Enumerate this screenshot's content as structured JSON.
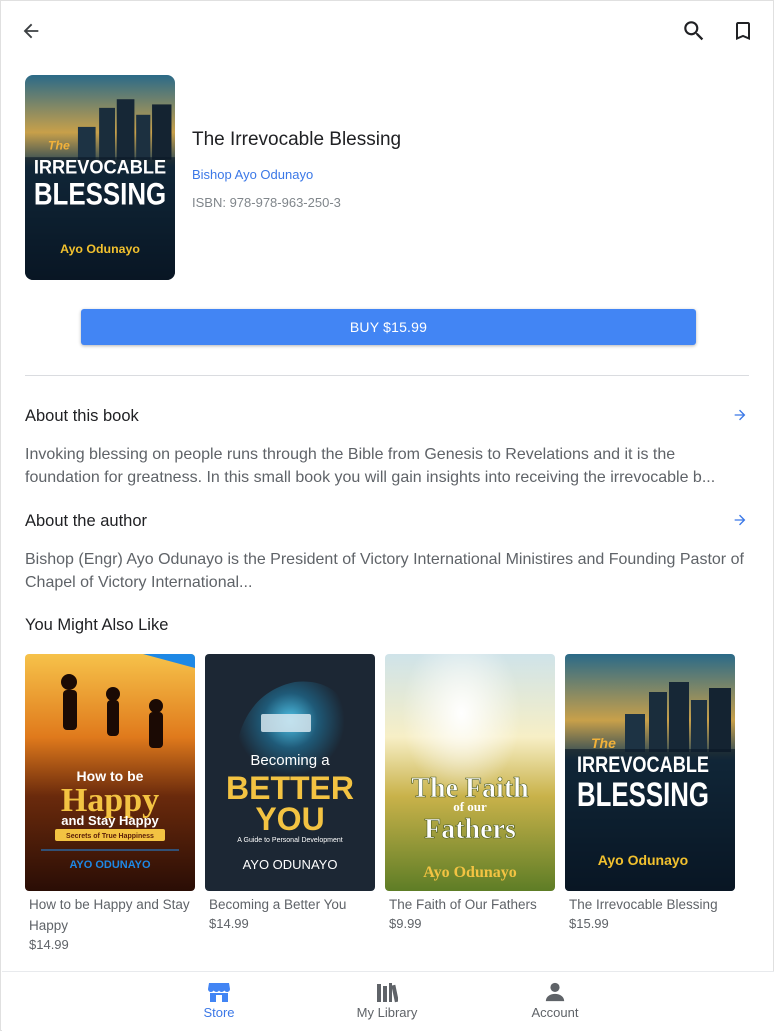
{
  "header": {
    "back_icon": "arrow-left-icon",
    "search_icon": "search-icon",
    "bookmark_icon": "bookmark-icon"
  },
  "book": {
    "title": "The Irrevocable Blessing",
    "author": "Bishop Ayo Odunayo",
    "isbn": "ISBN: 978-978-963-250-3",
    "cover": {
      "small_word": "The",
      "line1": "IRREVOCABLE",
      "line2": "BLESSING",
      "author": "Ayo Odunayo"
    }
  },
  "buy_button": {
    "label": "BUY $15.99"
  },
  "about_book": {
    "heading": "About this book",
    "text": "Invoking blessing on people runs through the Bible from Genesis to Revelations and it is the foundation for greatness. In this small book you will gain insights into receiving the irrevocable b..."
  },
  "about_author": {
    "heading": "About the author",
    "text": "Bishop (Engr) Ayo Odunayo is the President of Victory International Ministires and Founding Pastor of Chapel of Victory International..."
  },
  "recommendations": {
    "heading": "You Might Also Like",
    "items": [
      {
        "title": "How to be Happy and Stay Happy",
        "price": "$14.99",
        "cover": {
          "line1": "How to be",
          "line2": "Happy",
          "line3": "and Stay Happy",
          "banner": "Secrets of True Happiness",
          "author": "AYO ODUNAYO"
        }
      },
      {
        "title": "Becoming a Better You",
        "price": "$14.99",
        "cover": {
          "line1": "Becoming a",
          "line2": "BETTER",
          "line3": "YOU",
          "sub": "A Guide to Personal Development",
          "author": "AYO ODUNAYO"
        }
      },
      {
        "title": "The Faith of Our Fathers",
        "price": "$9.99",
        "cover": {
          "line1": "The Faith",
          "line2": "of our",
          "line3": "Fathers",
          "author": "Ayo Odunayo"
        }
      },
      {
        "title": "The Irrevocable Blessing",
        "price": "$15.99",
        "cover": {
          "small_word": "The",
          "line1": "IRREVOCABLE",
          "line2": "BLESSING",
          "author": "Ayo Odunayo"
        }
      }
    ]
  },
  "bottom_nav": {
    "active": "Store",
    "items": [
      {
        "label": "Store",
        "icon": "store-icon"
      },
      {
        "label": "My Library",
        "icon": "library-icon"
      },
      {
        "label": "Account",
        "icon": "account-icon"
      }
    ]
  },
  "colors": {
    "accent": "#4285f4",
    "link": "#3b78e7",
    "text_primary": "#202124",
    "text_secondary": "#5f6368"
  }
}
